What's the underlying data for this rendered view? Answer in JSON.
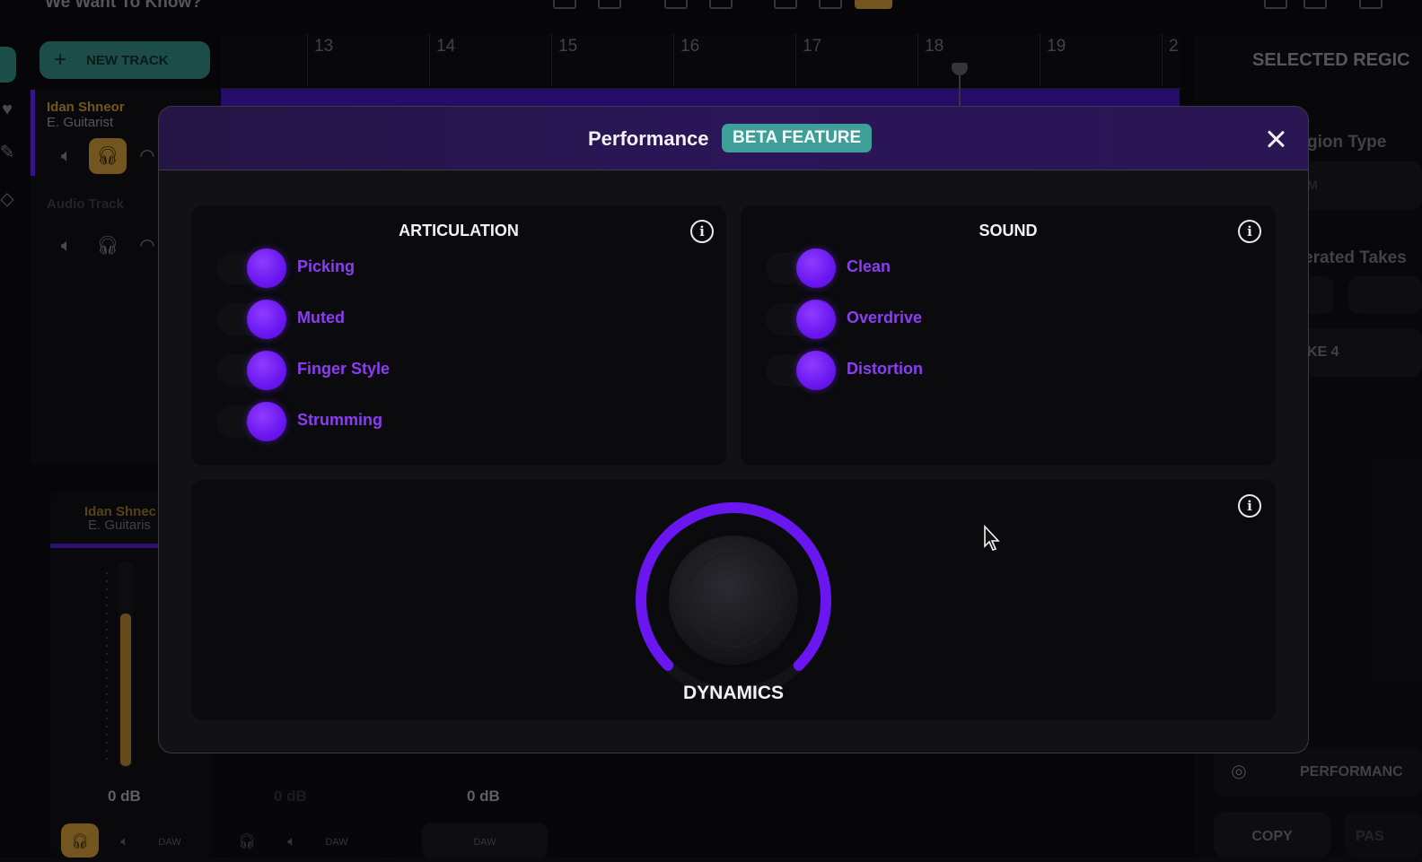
{
  "app": {
    "song_title": "We Want To Know?",
    "new_track_label": "NEW TRACK",
    "track": {
      "name": "Idan Shneor",
      "role": "E. Guitarist"
    },
    "track2_name": "Audio Track",
    "ruler_numbers": [
      "13",
      "14",
      "15",
      "16",
      "17",
      "18",
      "19",
      "2"
    ],
    "right_panel": {
      "header": "SELECTED REGIC",
      "region_type_fragment": "gion Type",
      "region_value_fragment": "M",
      "generated_takes_fragment": "erated Takes",
      "take_fragment": "KE 4",
      "performance_label": "PERFORMANC",
      "copy_label": "COPY",
      "paste_fragment": "PAS"
    },
    "mixer": {
      "strip_name": "Idan Shnec",
      "strip_role": "E. Guitaris",
      "levels": [
        "0 dB",
        "0 dB",
        "0 dB"
      ],
      "daw_label": "DAW"
    }
  },
  "modal": {
    "title": "Performance",
    "badge": "BETA FEATURE",
    "articulation": {
      "title": "ARTICULATION",
      "options": [
        "Picking",
        "Muted",
        "Finger Style",
        "Strumming"
      ]
    },
    "sound": {
      "title": "SOUND",
      "options": [
        "Clean",
        "Overdrive",
        "Distortion"
      ]
    },
    "dynamics": {
      "label": "DYNAMICS",
      "level": 1.0
    }
  },
  "colors": {
    "accent_purple": "#6a16f0",
    "option_text_purple": "#8b3cf5",
    "badge_teal": "#3f9f98",
    "track_gold": "#b88a32",
    "new_track_teal": "#2f7d74"
  },
  "icons": {
    "close": "close-icon",
    "info": "info-icon",
    "mute": "mute-icon",
    "headphones": "headphones-icon",
    "plus": "plus-icon",
    "cursor": "mouse-cursor-icon"
  }
}
